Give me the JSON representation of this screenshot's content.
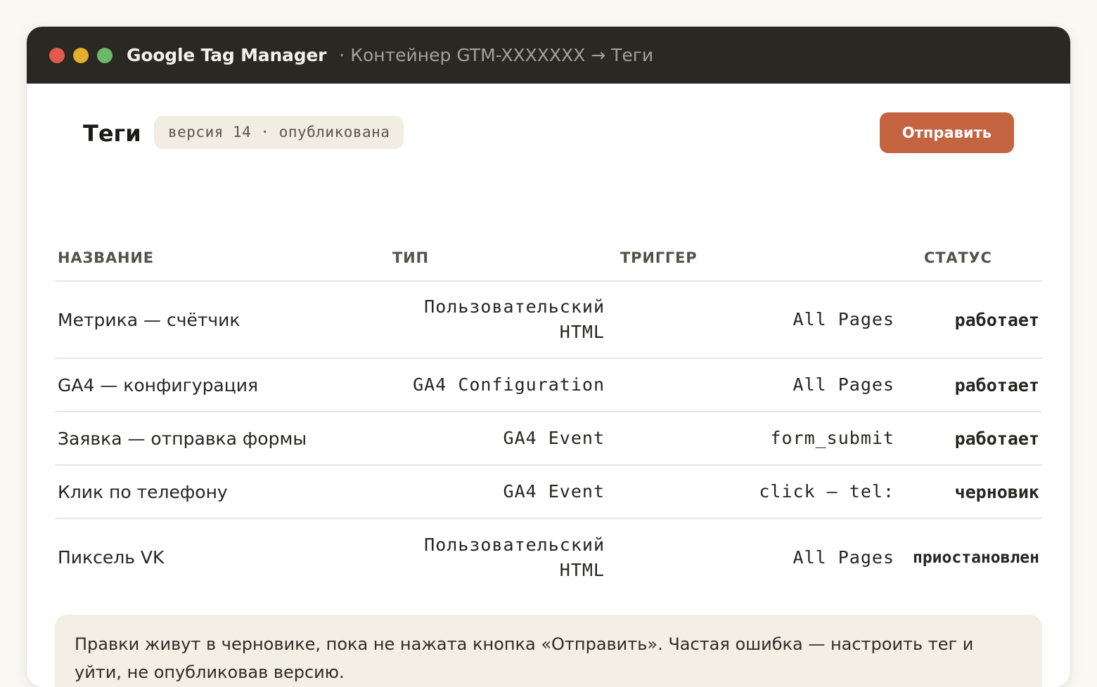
{
  "window": {
    "app_name": "Google Tag Manager",
    "breadcrumb": "· Контейнер GTM-XXXXXXX → Теги",
    "traffic_lights": [
      "#e05b4e",
      "#e3ae2c",
      "#6bb86b"
    ]
  },
  "header": {
    "title": "Теги",
    "version_badge": "версия 14 · опубликована",
    "submit_label": "Отправить"
  },
  "table": {
    "columns": [
      "НАЗВАНИЕ",
      "ТИП",
      "ТРИГГЕР",
      "СТАТУС"
    ],
    "rows": [
      {
        "name": "Метрика — счётчик",
        "type": "Пользовательский HTML",
        "trigger": "All Pages",
        "status": "работает"
      },
      {
        "name": "GA4 — конфигурация",
        "type": "GA4 Configuration",
        "trigger": "All Pages",
        "status": "работает"
      },
      {
        "name": "Заявка — отправка формы",
        "type": "GA4 Event",
        "trigger": "form_submit",
        "status": "работает"
      },
      {
        "name": "Клик по телефону",
        "type": "GA4 Event",
        "trigger": "click — tel:",
        "status": "черновик"
      },
      {
        "name": "Пиксель VK",
        "type": "Пользовательский HTML",
        "trigger": "All Pages",
        "status": "приостановлен"
      }
    ]
  },
  "note": {
    "text": "Правки живут в черновике, пока не нажата кнопка «Отправить». Частая ошибка — настроить тег и уйти, не опубликовав версию."
  },
  "colors": {
    "accent": "#c4633f",
    "status_active": "#3e7a4d",
    "status_draft": "#c05f38",
    "status_paused": "#97938a"
  }
}
